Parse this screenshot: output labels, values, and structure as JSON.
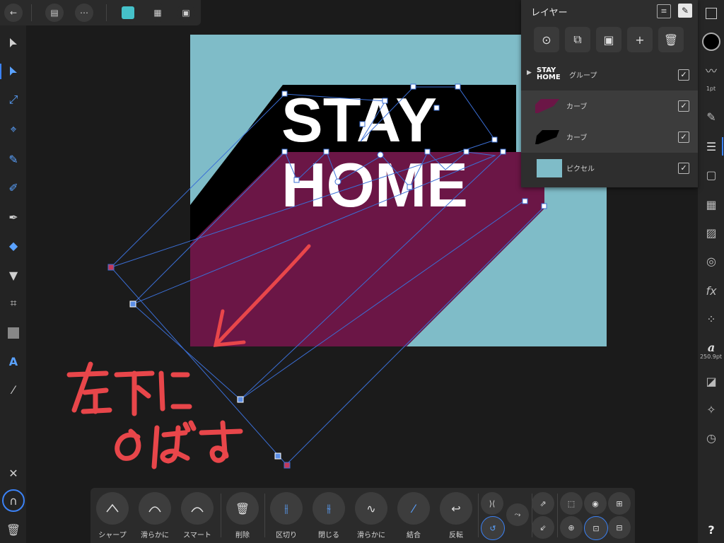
{
  "layers_panel": {
    "title": "レイヤー",
    "rows": [
      {
        "thumb_text_1": "STAY",
        "thumb_text_2": "HOME",
        "label": "グループ",
        "checked": "✓"
      },
      {
        "label": "カーブ",
        "checked": "✓",
        "color": "#6b1646"
      },
      {
        "label": "カーブ",
        "checked": "✓",
        "color": "#000000"
      },
      {
        "label": "ピクセル",
        "checked": "✓",
        "color": "#7fbcc8"
      }
    ]
  },
  "artwork": {
    "line1": "STAY",
    "line2": "HOME",
    "background_color": "#7fbcc8",
    "shadow_color": "#6b1646",
    "annotation_color": "#e8464a"
  },
  "right_toolbar": {
    "stroke_width": "1pt",
    "font_size": "250.9pt"
  },
  "bottom_toolbar": {
    "items": [
      {
        "label": "シャープ",
        "icon": "sharp-node-icon"
      },
      {
        "label": "滑らかに",
        "icon": "smooth-node-icon"
      },
      {
        "label": "スマート",
        "icon": "smart-node-icon"
      },
      {
        "label": "削除",
        "icon": "trash-icon"
      },
      {
        "label": "区切り",
        "icon": "break-icon"
      },
      {
        "label": "閉じる",
        "icon": "close-curve-icon"
      },
      {
        "label": "滑らかに",
        "icon": "smooth-curve-icon"
      },
      {
        "label": "結合",
        "icon": "join-icon"
      },
      {
        "label": "反転",
        "icon": "reverse-icon"
      }
    ]
  },
  "help_label": "?"
}
